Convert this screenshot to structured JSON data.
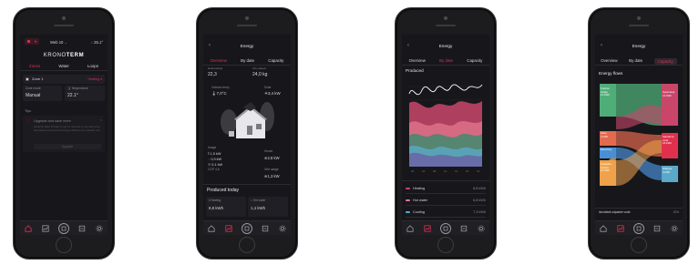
{
  "screen1": {
    "weather": "Web 10",
    "temp": "25.1°",
    "logo_light": "KRONO",
    "logo_bold": "TERM",
    "tabs": [
      "Zones",
      "Water",
      "Loops"
    ],
    "zone_name": "Zone 1",
    "zone_status": "Heating",
    "zone_mode_label": "Zone mode",
    "zone_mode_value": "Manual",
    "temp_label": "Temperature",
    "temp_value": "22.1°",
    "tips_label": "Tips",
    "tip_title": "Upgrade and save more",
    "tip_body": "Install the latest firmware to get the most out of your heat pump. New features and improved energy efficiency are available now.",
    "tip_button": "Upgrade"
  },
  "screen2": {
    "title": "Energy",
    "tabs": [
      "Overview",
      "By date",
      "Capacity"
    ],
    "stat1_label": "Heat pumps",
    "stat1_value": "22,3",
    "stat2_label": "CO₂ saved",
    "stat2_value": "24,0 kg",
    "outdoor_label": "Outdoor temp",
    "outdoor_value": "7,0°C",
    "solar_label": "Solar",
    "solar_value": "3,4 kW",
    "usage_label": "Usage",
    "usage_values": [
      "1,5 kW",
      "0,9 kW",
      "0,1 kW"
    ],
    "cop_value": "COP 4,8",
    "house_label": "House",
    "house_value": "2,8 kW",
    "grid_label": "Grid usage",
    "grid_value": "1,3 kW",
    "produced_title": "Produced today",
    "heating_label": "Heating",
    "heating_value": "8,8 kWh",
    "hotwater_label": "Hot water",
    "hotwater_value": "1,4 kWh"
  },
  "screen3": {
    "title": "Energy",
    "tabs": [
      "Overview",
      "By date",
      "Capacity"
    ],
    "chart_title": "Produced",
    "legend": [
      {
        "label": "Heating",
        "value": "8,8 kWh",
        "color": "#c9466a"
      },
      {
        "label": "Hot water",
        "value": "6,8 kWh",
        "color": "#e37a8f"
      },
      {
        "label": "Cooling",
        "value": "7,3 kWh",
        "color": "#5aa9c8"
      }
    ]
  },
  "screen4": {
    "title": "Energy",
    "tabs": [
      "Overview",
      "By date",
      "Capacity"
    ],
    "flows_title": "Energy flows",
    "left_nodes": [
      {
        "label": "Toplota okolja",
        "value": "12 kWh",
        "color": "#4fae78"
      },
      {
        "label": "Solar",
        "value": "4 kWh",
        "color": "#e36a4e"
      },
      {
        "label": "Electricity",
        "value": "7 kWh",
        "color": "#4a8fd4"
      },
      {
        "label": "Odpadna toplota",
        "value": "10 kWh",
        "color": "#f0a24a"
      }
    ],
    "right_nodes": [
      {
        "label": "Ogrevanje",
        "value": "12 kWh",
        "color": "#c9466a"
      },
      {
        "label": "Sanitarna voda",
        "value": "18 kWh",
        "color": "#e0304e"
      },
      {
        "label": "Hlajenje",
        "value": "4 kWh",
        "color": "#5aa9c8"
      }
    ],
    "footer_label": "Izkoristek odpadne vode",
    "footer_value": "10%"
  },
  "colors": {
    "accent": "#e0304e",
    "screen_bg": "#17171b"
  }
}
